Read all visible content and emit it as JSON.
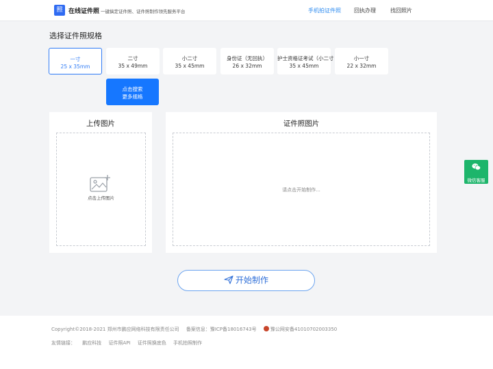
{
  "header": {
    "logo_text": "照",
    "brand": "在线证件照",
    "slogan": "一键搞定证件照、证件照制作领先服务平台",
    "nav": [
      "手机拍证件照",
      "回执办理",
      "找回照片"
    ]
  },
  "section_title": "选择证件照规格",
  "sizes": [
    {
      "name": "一寸",
      "dims": "25 x 35mm"
    },
    {
      "name": "二寸",
      "dims": "35 x 49mm"
    },
    {
      "name": "小二寸",
      "dims": "35 x 45mm"
    },
    {
      "name": "身份证（无回执）",
      "dims": "26 x 32mm"
    },
    {
      "name": "护士资格证考试（小二寸",
      "dims": "35 x 45mm"
    },
    {
      "name": "小一寸",
      "dims": "22 x 32mm"
    }
  ],
  "more": {
    "line1": "点击搜索",
    "line2": "更多规格"
  },
  "upload": {
    "title": "上传图片",
    "hint": "点击上传图片"
  },
  "result": {
    "title": "证件照图片",
    "hint": "请点击开始制作..."
  },
  "start_button": "开始制作",
  "wechat": "微信客服",
  "footer": {
    "copyright": "Copyright©2018-2021 郑州市鹏应网络科技有限责任公司",
    "icp": "备案信息：豫ICP备18016743号",
    "police": "豫公网安备41010702003350",
    "links_label": "友情链接：",
    "links": [
      "鹏应科技",
      "证件照API",
      "证件照换底色",
      "手机拍照制作"
    ]
  },
  "colors": {
    "accent": "#1677ff",
    "selected": "#2f7bf5",
    "wechat": "#1db56b"
  }
}
